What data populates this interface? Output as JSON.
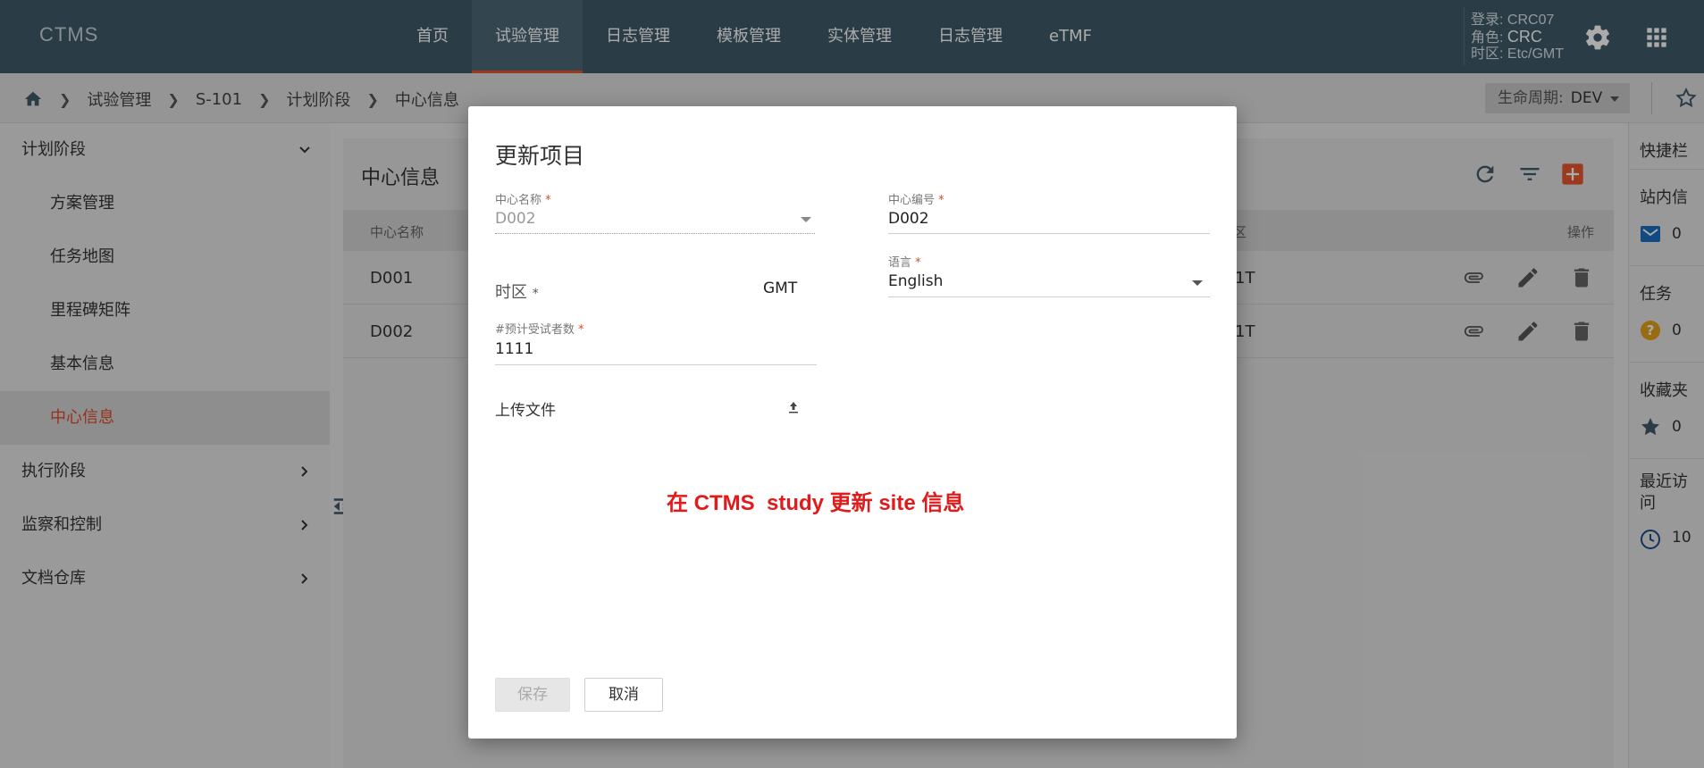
{
  "app": {
    "brand": "CTMS"
  },
  "nav": {
    "items": [
      "首页",
      "试验管理",
      "日志管理",
      "模板管理",
      "实体管理",
      "日志管理",
      "eTMF"
    ],
    "active_index": 1
  },
  "user": {
    "login_label": "登录: ",
    "login_value": "CRC07",
    "role_label": "角色: ",
    "role_value": "CRC",
    "tz_label": "时区: ",
    "tz_value": "Etc/GMT"
  },
  "breadcrumb": {
    "items": [
      "试验管理",
      "S-101",
      "计划阶段",
      "中心信息"
    ]
  },
  "lifecycle": {
    "label": "生命周期:",
    "value": "DEV"
  },
  "sidebar": {
    "items": [
      {
        "label": "计划阶段",
        "level": 0,
        "chevron": "down"
      },
      {
        "label": "方案管理",
        "level": 1
      },
      {
        "label": "任务地图",
        "level": 1
      },
      {
        "label": "里程碑矩阵",
        "level": 1
      },
      {
        "label": "基本信息",
        "level": 1
      },
      {
        "label": "中心信息",
        "level": 1,
        "active": true
      },
      {
        "label": "执行阶段",
        "level": 0,
        "chevron": "right"
      },
      {
        "label": "监察和控制",
        "level": 0,
        "chevron": "right"
      },
      {
        "label": "文档仓库",
        "level": 0,
        "chevron": "right"
      }
    ]
  },
  "main": {
    "title": "中心信息",
    "columns": {
      "name": "中心名称",
      "tz_partial": "区",
      "actions": "操作"
    },
    "rows": [
      {
        "name": "D001",
        "tz_partial": "1T"
      },
      {
        "name": "D002",
        "tz_partial": "1T"
      }
    ]
  },
  "quick": {
    "title": "快捷栏",
    "blocks": [
      {
        "label": "站内信",
        "count": "0",
        "icon": "mail-icon"
      },
      {
        "label": "任务",
        "count": "0",
        "icon": "question-icon"
      },
      {
        "label": "收藏夹",
        "count": "0",
        "icon": "star-icon"
      },
      {
        "label": "最近访问",
        "count": "10",
        "icon": "clock-icon"
      }
    ]
  },
  "modal": {
    "title": "更新项目",
    "fields": {
      "site_name": {
        "label": "中心名称",
        "value": "D002"
      },
      "site_code": {
        "label": "中心编号",
        "value": "D002"
      },
      "timezone": {
        "label": "时区",
        "value": "GMT"
      },
      "language": {
        "label": "语言",
        "value": "English"
      },
      "expected_subjects": {
        "label": "#预计受试者数",
        "value": "1111"
      },
      "upload": {
        "label": "上传文件"
      }
    },
    "required_mark": "*",
    "annotation": "在 CTMS  study 更新 site 信息",
    "save_label": "保存",
    "cancel_label": "取消"
  },
  "colors": {
    "topbar": "#3f5a68",
    "accent": "#e0492b",
    "annotation": "#e11b1b"
  }
}
